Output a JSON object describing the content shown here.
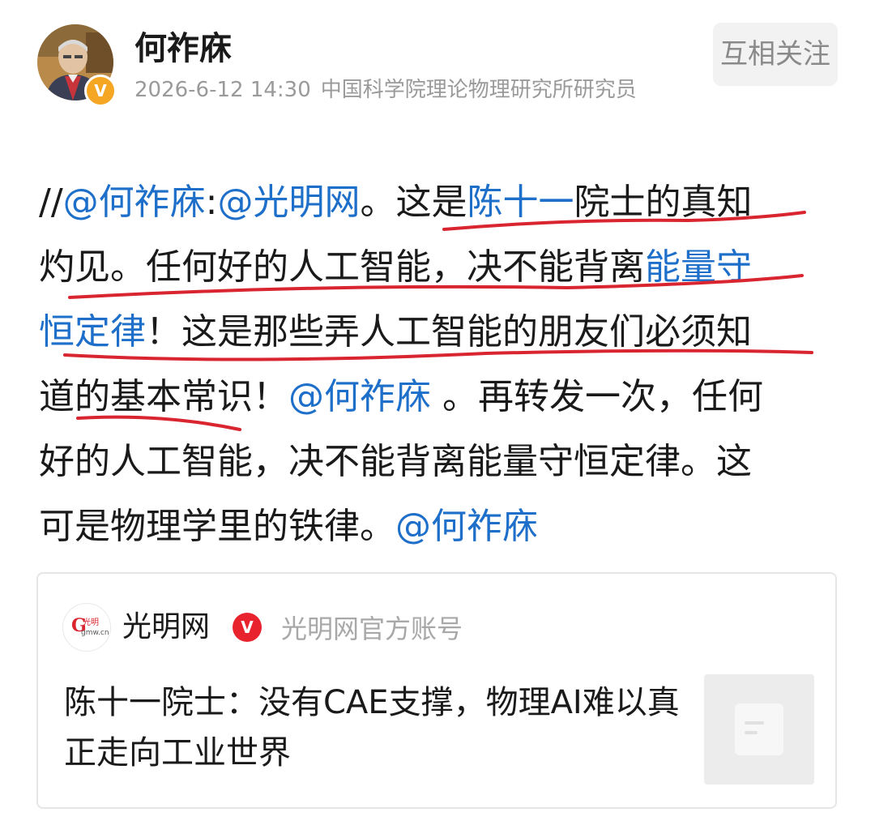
{
  "author": {
    "name": "何祚庥",
    "badge_letter": "V",
    "timestamp": "2026-6-12 14:30",
    "title": "中国科学院理论物理研究所研究员",
    "follow_label": "互相关注"
  },
  "post": {
    "lines": [
      [
        {
          "text": "//",
          "link": false
        },
        {
          "text": "@何祚庥",
          "link": true
        },
        {
          "text": ":",
          "link": false
        },
        {
          "text": "@光明网",
          "link": true
        },
        {
          "text": "。这是",
          "link": false
        },
        {
          "text": "陈十一",
          "link": true
        },
        {
          "text": "院士的真知",
          "link": false
        }
      ],
      [
        {
          "text": "灼见。任何好的人工智能，决不能背离",
          "link": false
        },
        {
          "text": "能量守",
          "link": true
        }
      ],
      [
        {
          "text": "恒定律",
          "link": true
        },
        {
          "text": "！这是那些弄人工智能的朋友们必须知",
          "link": false
        }
      ],
      [
        {
          "text": "道的基本常识！",
          "link": false
        },
        {
          "text": "@何祚庥",
          "link": true
        },
        {
          "text": " 。再转发一次，任何",
          "link": false
        }
      ],
      [
        {
          "text": "好的人工智能，决不能背离能量守恒定律。这",
          "link": false
        }
      ],
      [
        {
          "text": "可是物理学里的铁律。",
          "link": false
        },
        {
          "text": "@何祚庥",
          "link": true
        }
      ]
    ],
    "link_color": "#1e6fc9",
    "underline_color": "#d9252f"
  },
  "card": {
    "source_name": "光明网",
    "source_badge": "V",
    "source_desc": "光明网官方账号",
    "title": "陈十一院士：没有CAE支撑，物理AI难以真正走向工业世界",
    "logo_text": "gmw.cn"
  }
}
